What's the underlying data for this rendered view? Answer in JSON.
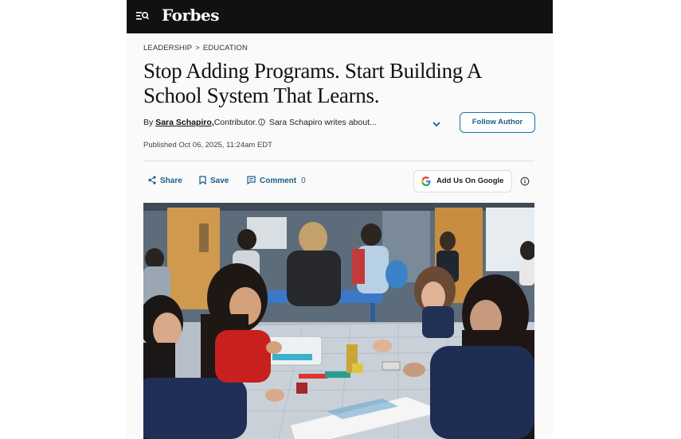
{
  "header": {
    "logo": "Forbes",
    "menu_icon": "menu-search-icon",
    "background": "#111111"
  },
  "breadcrumb": {
    "section": "LEADERSHIP",
    "separator": ">",
    "subsection": "EDUCATION"
  },
  "article": {
    "headline": "Stop Adding Programs. Start Building A School System That Learns.",
    "byline_prefix": "By",
    "author": "Sara Schapiro,",
    "role": "Contributor.",
    "author_blurb": "Sara Schapiro writes about...",
    "follow_label": "Follow Author",
    "published": "Published Oct 06, 2025, 11:24am EDT"
  },
  "actions": {
    "share_label": "Share",
    "save_label": "Save",
    "comment_label": "Comment",
    "comment_count": "0",
    "google_label": "Add Us On Google",
    "accent_color": "#1a5f8a"
  },
  "image": {
    "subject": "Students working on a robotics activity at a classroom table"
  }
}
